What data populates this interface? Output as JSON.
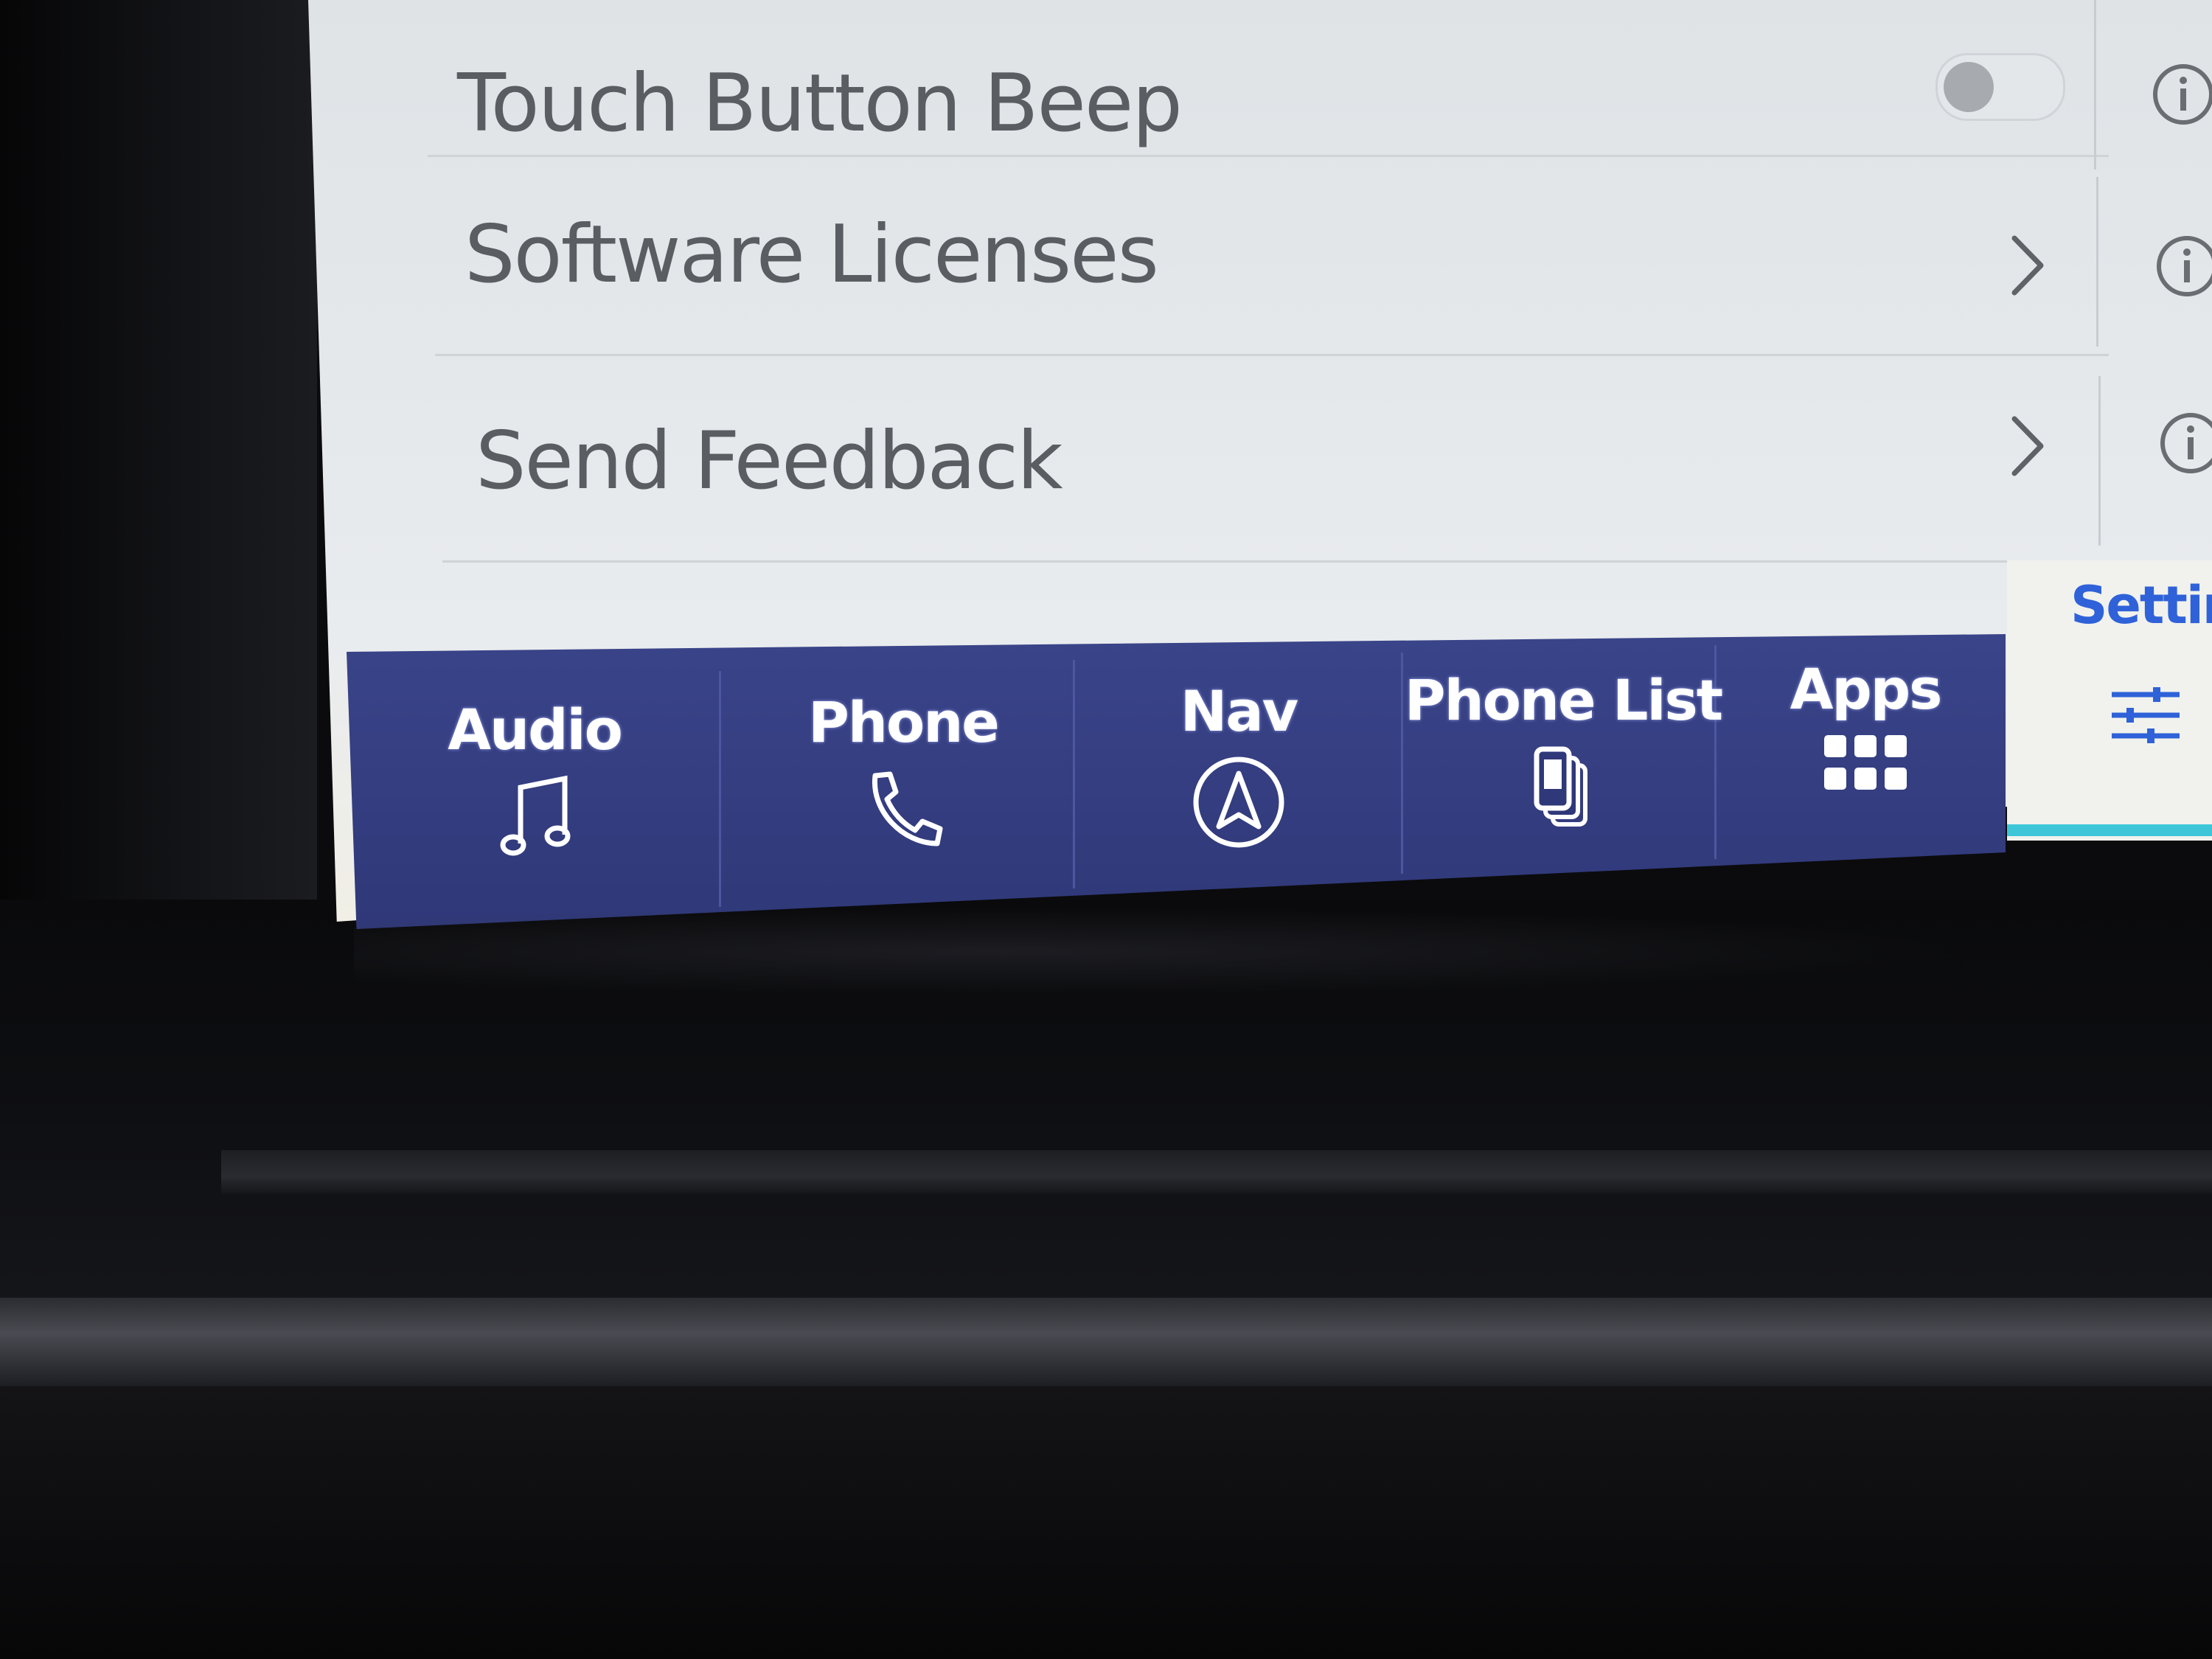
{
  "settings_list": {
    "rows": [
      {
        "label": "Touch Button Beep",
        "control": "toggle",
        "toggle_on": false
      },
      {
        "label": "Software Licenses",
        "control": "chevron"
      },
      {
        "label": "Send Feedback",
        "control": "chevron"
      }
    ]
  },
  "nav_bar": {
    "items": [
      {
        "label": "Audio",
        "icon": "music-note-icon"
      },
      {
        "label": "Phone",
        "icon": "phone-icon"
      },
      {
        "label": "Nav",
        "icon": "navigation-arrow-icon"
      },
      {
        "label": "Phone List",
        "icon": "phone-list-icon"
      },
      {
        "label": "Apps",
        "icon": "apps-grid-icon"
      }
    ],
    "settings": {
      "label": "Settings",
      "icon": "sliders-icon"
    }
  },
  "colors": {
    "nav_bg": "#3a4489",
    "settings_accent": "#2f62d8",
    "active_underline": "#3ec6d8",
    "row_text": "#5a5d61"
  }
}
